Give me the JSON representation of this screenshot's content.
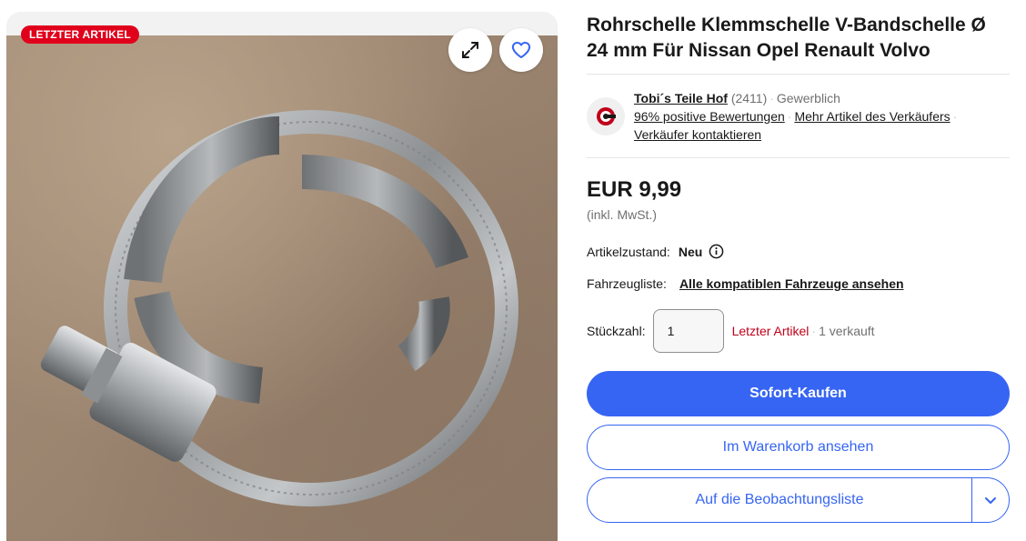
{
  "gallery": {
    "badge": "LETZTER ARTIKEL",
    "expand_icon": "expand-icon",
    "heart_icon": "heart-icon"
  },
  "listing": {
    "title": "Rohrschelle Klemmschelle V-Bandschelle Ø 24 mm Für Nissan Opel Renault Volvo"
  },
  "seller": {
    "name": "Tobi´s Teile Hof",
    "score": "(2411)",
    "type": "Gewerblich",
    "feedback": "96% positive Bewertungen",
    "more_items": "Mehr Artikel des Verkäufers",
    "contact": "Verkäufer kontaktieren"
  },
  "price": {
    "value": "EUR 9,99",
    "tax_note": "(inkl. MwSt.)"
  },
  "condition": {
    "label": "Artikelzustand:",
    "value": "Neu"
  },
  "vehicles": {
    "label": "Fahrzeugliste:",
    "link": "Alle kompatiblen Fahrzeuge ansehen"
  },
  "quantity": {
    "label": "Stückzahl:",
    "value": "1",
    "last_item": "Letzter Artikel",
    "sold": "1 verkauft"
  },
  "actions": {
    "buy_now": "Sofort-Kaufen",
    "view_cart": "Im Warenkorb ansehen",
    "watchlist": "Auf die Beobachtungsliste"
  },
  "colors": {
    "primary": "#3665f3",
    "badge": "#e0001b",
    "last_item": "#c0001a"
  }
}
